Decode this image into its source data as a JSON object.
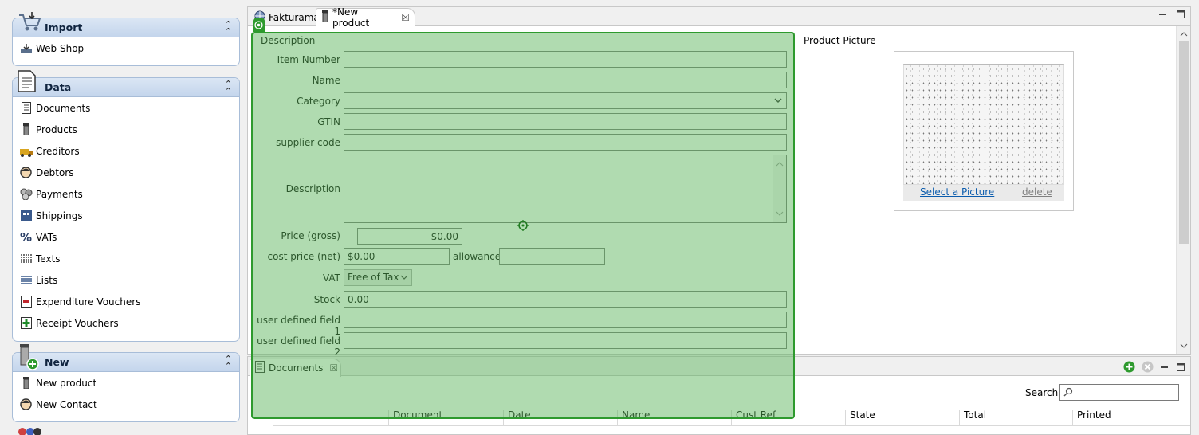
{
  "sidebar": {
    "import": {
      "title": "Import",
      "items": [
        {
          "label": "Web Shop",
          "icon": "web-shop-icon"
        }
      ]
    },
    "data": {
      "title": "Data",
      "items": [
        {
          "label": "Documents",
          "icon": "documents-icon"
        },
        {
          "label": "Products",
          "icon": "products-icon"
        },
        {
          "label": "Creditors",
          "icon": "creditors-icon"
        },
        {
          "label": "Debtors",
          "icon": "debtors-icon"
        },
        {
          "label": "Payments",
          "icon": "payments-icon"
        },
        {
          "label": "Shippings",
          "icon": "shippings-icon"
        },
        {
          "label": "VATs",
          "icon": "percent-icon"
        },
        {
          "label": "Texts",
          "icon": "texts-icon"
        },
        {
          "label": "Lists",
          "icon": "lists-icon"
        },
        {
          "label": "Expenditure Vouchers",
          "icon": "expenditure-voucher-icon"
        },
        {
          "label": "Receipt Vouchers",
          "icon": "receipt-voucher-icon"
        }
      ]
    },
    "new": {
      "title": "New",
      "items": [
        {
          "label": "New product",
          "icon": "products-icon"
        },
        {
          "label": "New Contact",
          "icon": "contact-icon"
        }
      ]
    }
  },
  "editor": {
    "tabs": [
      {
        "label": "Fakturama"
      },
      {
        "label": "*New product"
      }
    ],
    "description_group": "Description",
    "picture_group": "Product Picture",
    "fields": {
      "item_number": {
        "label": "Item Number",
        "value": ""
      },
      "name": {
        "label": "Name",
        "value": ""
      },
      "category": {
        "label": "Category",
        "value": ""
      },
      "gtin": {
        "label": "GTIN",
        "value": ""
      },
      "supplier_code": {
        "label": "supplier code",
        "value": ""
      },
      "description": {
        "label": "Description",
        "value": ""
      },
      "price_gross": {
        "label": "Price (gross)",
        "value": "$0.00"
      },
      "cost_price": {
        "label": "cost price (net)",
        "value": "$0.00"
      },
      "allowance": {
        "label": "allowance",
        "value": ""
      },
      "vat": {
        "label": "VAT",
        "value": "Free of Tax"
      },
      "stock": {
        "label": "Stock",
        "value": "0.00"
      },
      "udf1": {
        "label": "user defined field 1",
        "value": ""
      },
      "udf2": {
        "label": "user defined field 2",
        "value": ""
      }
    },
    "picture": {
      "select_label": "Select a Picture",
      "delete_label": "delete"
    }
  },
  "documents_view": {
    "tab": "Documents",
    "search_label": "Search:",
    "search_value": "",
    "columns": [
      "Document",
      "Date",
      "Name",
      "Cust.Ref.",
      "State",
      "Total",
      "Printed"
    ]
  },
  "colors": {
    "overlay": "#2e9a2e",
    "link": "#0b5cad",
    "panel_header": "#c4d5ec"
  }
}
